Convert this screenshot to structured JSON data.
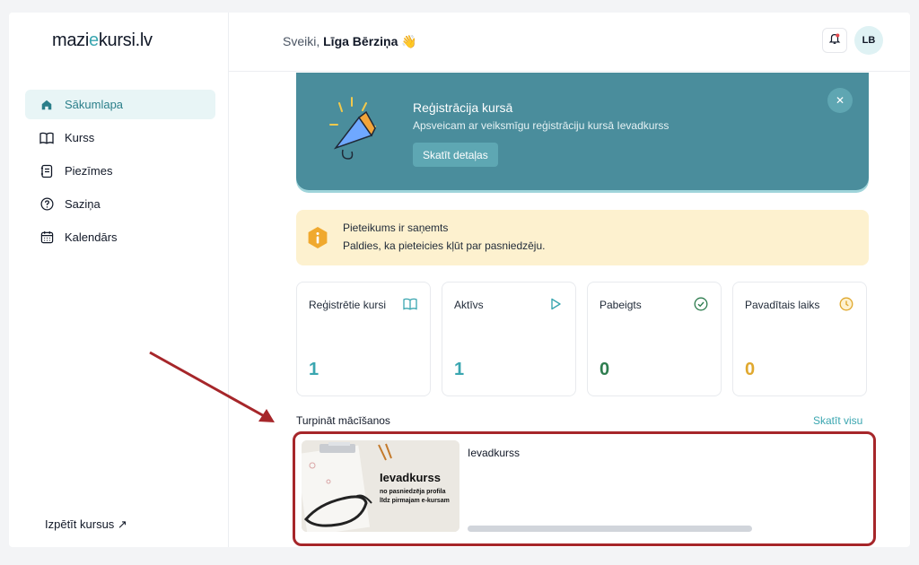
{
  "app": {
    "logo_prefix": "mazi",
    "logo_accent": "e",
    "logo_suffix": "kursi.lv"
  },
  "header": {
    "greeting": "Sveiki,",
    "user_name": "Līga Bērziņa 👋",
    "avatar_initials": "LB"
  },
  "sidebar": {
    "items": [
      {
        "label": "Sākumlapa",
        "icon": "home-icon",
        "active": true
      },
      {
        "label": "Kurss",
        "icon": "book-icon"
      },
      {
        "label": "Piezīmes",
        "icon": "notes-icon"
      },
      {
        "label": "Saziņa",
        "icon": "help-circle-icon"
      },
      {
        "label": "Kalendārs",
        "icon": "calendar-icon"
      }
    ],
    "explore_label": "Izpētīt kursus ↗"
  },
  "banner": {
    "title": "Reģistrācija kursā",
    "text": "Apsveicam ar veiksmīgu reģistrāciju kursā Ievadkurss",
    "button": "Skatīt detaļas",
    "close": "✕"
  },
  "notice": {
    "title": "Pieteikums ir saņemts",
    "text": "Paldies, ka pieteicies kļūt par pasniedzēju."
  },
  "stats": [
    {
      "label": "Reģistrētie kursi",
      "value": "1",
      "color": "#3aa6b0",
      "icon": "book-icon"
    },
    {
      "label": "Aktīvs",
      "value": "1",
      "color": "#3aa6b0",
      "icon": "play-icon"
    },
    {
      "label": "Pabeigts",
      "value": "0",
      "color": "#2e7d4f",
      "icon": "check-circle-icon"
    },
    {
      "label": "Pavadītais laiks",
      "value": "0",
      "color": "#e0a82e",
      "icon": "clock-icon"
    }
  ],
  "continue": {
    "title": "Turpināt mācīšanos",
    "see_all": "Skatīt visu",
    "course": {
      "name": "Ievadkurss",
      "thumb_title": "Ievadkurss",
      "thumb_subtitle": "no pasniedzēja profila līdz pirmajam e-kursam",
      "progress": 0
    }
  },
  "colors": {
    "accent": "#3aa6b0",
    "banner": "#4a8d9c",
    "notice": "#fdf1cf",
    "highlight": "#a6262a"
  }
}
